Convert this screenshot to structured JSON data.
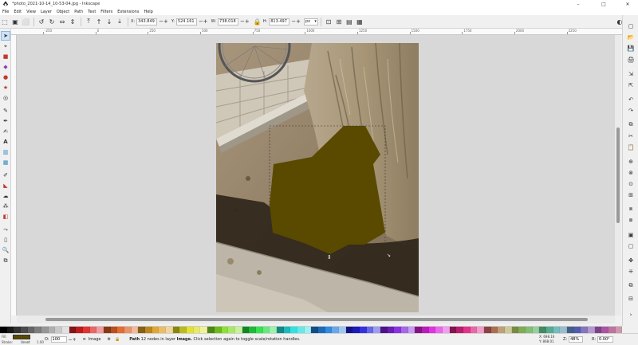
{
  "window": {
    "title": "*photo_2021-10-14_10-53-04.jpg - Inkscape",
    "minimize": "–",
    "maximize": "□",
    "close": "✕"
  },
  "menu": [
    "File",
    "Edit",
    "View",
    "Layer",
    "Object",
    "Path",
    "Text",
    "Filters",
    "Extensions",
    "Help"
  ],
  "toolbar": {
    "x_label": "X:",
    "x_value": "343.849",
    "y_label": "Y:",
    "y_value": "524.161",
    "w_label": "W:",
    "w_value": "738.018",
    "h_label": "H:",
    "h_value": "813.497",
    "unit": "px"
  },
  "ruler_labels": [
    "-250",
    "0",
    "250",
    "500",
    "750",
    "1000",
    "1250",
    "1500",
    "1750",
    "2000",
    "2250"
  ],
  "status": {
    "fill_label": "Fill:",
    "stroke_label": "Stroke:",
    "stroke_value": "Unset",
    "stroke_width": "1.00",
    "opacity_label": "O:",
    "opacity_value": "100",
    "layer_name": "Image",
    "message_bold1": "Path",
    "message_mid": "12 nodes in layer",
    "message_bold2": "Image.",
    "message_tail": "Click selection again to toggle scale/rotation handles.",
    "x_readout": "X: 698.16",
    "y_readout": "Y: 868.01",
    "zoom_label": "Z:",
    "zoom_value": "48%",
    "rot_label": "R:",
    "rot_value": "0.00°"
  },
  "colors": {
    "fill": "#5a4a00",
    "canvas": "#d8d8d8",
    "selection_cue": "#333333"
  },
  "icons": {
    "tools": [
      "selector-icon",
      "node-icon",
      "rect-icon",
      "box3d-icon",
      "circle-icon",
      "star-icon",
      "spiral-icon",
      "pencil-icon",
      "pen-icon",
      "calligraphy-icon",
      "text-icon",
      "gradient-icon",
      "mesh-icon",
      "dropper-icon",
      "paint-bucket-icon",
      "tweak-icon",
      "spray-icon",
      "eraser-icon",
      "connector-icon",
      "measure-icon",
      "zoom-icon",
      "pages-icon"
    ],
    "commands": [
      "new-icon",
      "open-icon",
      "save-icon",
      "print-icon",
      "import-icon",
      "export-icon",
      "undo-icon",
      "redo-icon",
      "copy-icon",
      "cut-icon",
      "paste-icon",
      "zoom-fit-icon",
      "zoom-drawing-icon",
      "zoom-page-icon",
      "duplicate-icon",
      "clone-icon",
      "unlink-icon",
      "group-icon",
      "ungroup-icon",
      "fill-stroke-icon",
      "text-font-icon",
      "layers-icon",
      "align-icon"
    ]
  }
}
